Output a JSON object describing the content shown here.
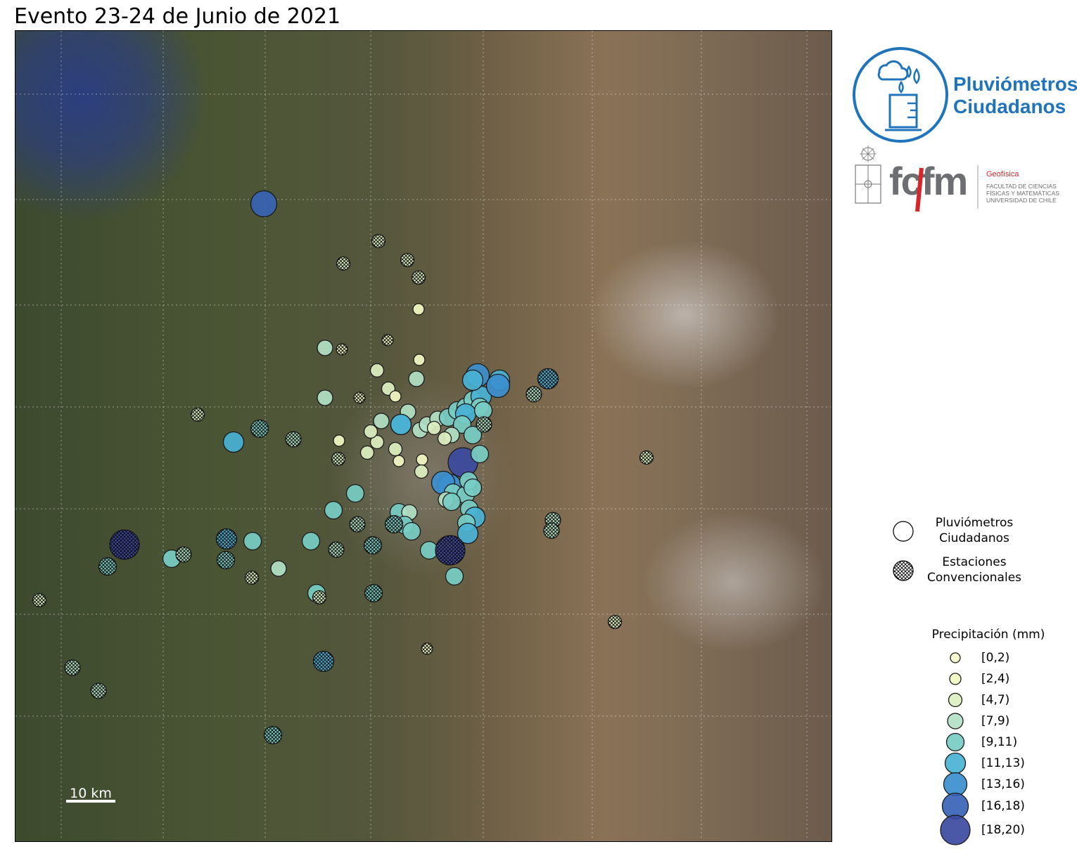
{
  "title": "Evento 23-24 de Junio de 2021",
  "scale_bar": {
    "label": "10 km"
  },
  "logos": {
    "pluviometros": {
      "line1": "Pluviómetros",
      "line2": "Ciudadanos",
      "color": "#1f74bb"
    },
    "fcfm": {
      "acronym": "fcfm",
      "department": "Geofísica",
      "line1": "FACULTAD DE CIENCIAS",
      "line2": "FÍSICAS Y MATEMÁTICAS",
      "line3": "UNIVERSIDAD DE CHILE",
      "accent": "#d7262b"
    }
  },
  "legend": {
    "types": [
      {
        "label": "Pluviómetros Ciudadanos",
        "line1": "Pluviómetros",
        "line2": "Ciudadanos",
        "hatched": false
      },
      {
        "label": "Estaciones Convencionales",
        "line1": "Estaciones",
        "line2": "Convencionales",
        "hatched": true
      }
    ],
    "precip_title": "Precipitación (mm)",
    "classes": [
      {
        "label": "[0,2)",
        "color": "#fdfdd0"
      },
      {
        "label": "[2,4)",
        "color": "#f3f8c3"
      },
      {
        "label": "[4,7)",
        "color": "#dcf0c0"
      },
      {
        "label": "[7,9)",
        "color": "#b2e1c4"
      },
      {
        "label": "[9,11)",
        "color": "#77cdc4"
      },
      {
        "label": "[11,13)",
        "color": "#49b2d4"
      },
      {
        "label": "[13,16)",
        "color": "#3b8fcf"
      },
      {
        "label": "[16,18)",
        "color": "#3763b5"
      },
      {
        "label": "[18,20)",
        "color": "#3b4aa0"
      }
    ]
  },
  "stations": {
    "ciudadanos": [
      {
        "c": 7,
        "p": [
          353,
          246
        ]
      },
      {
        "c": 5,
        "p": [
          310,
          585
        ]
      },
      {
        "c": 3,
        "p": [
          440,
          451
        ]
      },
      {
        "c": 3,
        "p": [
          440,
          522
        ]
      },
      {
        "c": 1,
        "p": [
          573,
          396
        ]
      },
      {
        "c": 1,
        "p": [
          574,
          468
        ]
      },
      {
        "c": 2,
        "p": [
          514,
          483
        ]
      },
      {
        "c": 2,
        "p": [
          530,
          509
        ]
      },
      {
        "c": 3,
        "p": [
          570,
          495
        ]
      },
      {
        "c": 1,
        "p": [
          540,
          520
        ]
      },
      {
        "c": 3,
        "p": [
          558,
          542
        ]
      },
      {
        "c": 5,
        "p": [
          548,
          560
        ]
      },
      {
        "c": 3,
        "p": [
          575,
          568
        ]
      },
      {
        "c": 3,
        "p": [
          585,
          560
        ]
      },
      {
        "c": 3,
        "p": [
          600,
          552
        ]
      },
      {
        "c": 4,
        "p": [
          615,
          550
        ]
      },
      {
        "c": 4,
        "p": [
          628,
          540
        ]
      },
      {
        "c": 4,
        "p": [
          640,
          535
        ]
      },
      {
        "c": 4,
        "p": [
          650,
          525
        ]
      },
      {
        "c": 5,
        "p": [
          662,
          520
        ]
      },
      {
        "c": 6,
        "p": [
          657,
          490
        ]
      },
      {
        "c": 5,
        "p": [
          688,
          497
        ]
      },
      {
        "c": 6,
        "p": [
          686,
          505
        ]
      },
      {
        "c": 5,
        "p": [
          650,
          497
        ]
      },
      {
        "c": 4,
        "p": [
          660,
          535
        ]
      },
      {
        "c": 5,
        "p": [
          640,
          545
        ]
      },
      {
        "c": 4,
        "p": [
          635,
          560
        ]
      },
      {
        "c": 4,
        "p": [
          650,
          575
        ]
      },
      {
        "c": 3,
        "p": [
          620,
          575
        ]
      },
      {
        "c": 2,
        "p": [
          610,
          580
        ]
      },
      {
        "c": 2,
        "p": [
          595,
          565
        ]
      },
      {
        "c": 1,
        "p": [
          578,
          610
        ]
      },
      {
        "c": 2,
        "p": [
          577,
          627
        ]
      },
      {
        "c": 1,
        "p": [
          545,
          612
        ]
      },
      {
        "c": 2,
        "p": [
          500,
          600
        ]
      },
      {
        "c": 2,
        "p": [
          514,
          585
        ]
      },
      {
        "c": 1,
        "p": [
          460,
          583
        ]
      },
      {
        "c": 2,
        "p": [
          505,
          570
        ]
      },
      {
        "c": 3,
        "p": [
          520,
          555
        ]
      },
      {
        "c": 2,
        "p": [
          540,
          595
        ]
      },
      {
        "c": 8,
        "p": [
          636,
          614
        ]
      },
      {
        "c": 6,
        "p": [
          617,
          647
        ]
      },
      {
        "c": 6,
        "p": [
          608,
          643
        ]
      },
      {
        "c": 4,
        "p": [
          622,
          657
        ]
      },
      {
        "c": 3,
        "p": [
          612,
          667
        ]
      },
      {
        "c": 4,
        "p": [
          640,
          660
        ]
      },
      {
        "c": 4,
        "p": [
          620,
          670
        ]
      },
      {
        "c": 4,
        "p": [
          645,
          680
        ]
      },
      {
        "c": 5,
        "p": [
          653,
          692
        ]
      },
      {
        "c": 4,
        "p": [
          641,
          700
        ]
      },
      {
        "c": 5,
        "p": [
          643,
          715
        ]
      },
      {
        "c": 4,
        "p": [
          483,
          658
        ]
      },
      {
        "c": 4,
        "p": [
          452,
          682
        ]
      },
      {
        "c": 4,
        "p": [
          545,
          685
        ]
      },
      {
        "c": 3,
        "p": [
          560,
          685
        ]
      },
      {
        "c": 4,
        "p": [
          553,
          703
        ]
      },
      {
        "c": 4,
        "p": [
          563,
          712
        ]
      },
      {
        "c": 4,
        "p": [
          420,
          726
        ]
      },
      {
        "c": 4,
        "p": [
          337,
          726
        ]
      },
      {
        "c": 4,
        "p": [
          222,
          751
        ]
      },
      {
        "c": 3,
        "p": [
          374,
          765
        ]
      },
      {
        "c": 4,
        "p": [
          588,
          739
        ]
      },
      {
        "c": 4,
        "p": [
          624,
          776
        ]
      },
      {
        "c": 4,
        "p": [
          428,
          800
        ]
      },
      {
        "c": 5,
        "p": [
          548,
          560
        ]
      },
      {
        "c": 4,
        "p": [
          665,
          540
        ]
      },
      {
        "c": 4,
        "p": [
          660,
          602
        ]
      },
      {
        "c": 4,
        "p": [
          644,
          640
        ]
      },
      {
        "c": 4,
        "p": [
          650,
          650
        ]
      }
    ],
    "convencionales": [
      {
        "c": 2,
        "p": [
          516,
          299
        ]
      },
      {
        "c": 2,
        "p": [
          466,
          331
        ]
      },
      {
        "c": 2,
        "p": [
          557,
          326
        ]
      },
      {
        "c": 2,
        "p": [
          573,
          351
        ]
      },
      {
        "c": 1,
        "p": [
          464,
          453
        ]
      },
      {
        "c": 1,
        "p": [
          529,
          440
        ]
      },
      {
        "c": 1,
        "p": [
          489,
          522
        ]
      },
      {
        "c": 2,
        "p": [
          259,
          546
        ]
      },
      {
        "c": 4,
        "p": [
          347,
          566
        ]
      },
      {
        "c": 3,
        "p": [
          395,
          581
        ]
      },
      {
        "c": 2,
        "p": [
          459,
          609
        ]
      },
      {
        "c": 5,
        "p": [
          757,
          495
        ]
      },
      {
        "c": 3,
        "p": [
          737,
          517
        ]
      },
      {
        "c": 2,
        "p": [
          897,
          607
        ]
      },
      {
        "c": 8,
        "p": [
          155,
          731
        ]
      },
      {
        "c": 5,
        "p": [
          300,
          723
        ]
      },
      {
        "c": 4,
        "p": [
          299,
          753
        ]
      },
      {
        "c": 3,
        "p": [
          239,
          745
        ]
      },
      {
        "c": 4,
        "p": [
          131,
          762
        ]
      },
      {
        "c": 2,
        "p": [
          336,
          778
        ]
      },
      {
        "c": 2,
        "p": [
          34,
          810
        ]
      },
      {
        "c": 3,
        "p": [
          486,
          702
        ]
      },
      {
        "c": 4,
        "p": [
          508,
          732
        ]
      },
      {
        "c": 3,
        "p": [
          456,
          738
        ]
      },
      {
        "c": 4,
        "p": [
          538,
          702
        ]
      },
      {
        "c": 8,
        "p": [
          618,
          739
        ]
      },
      {
        "c": 4,
        "p": [
          509,
          800
        ]
      },
      {
        "c": 2,
        "p": [
          432,
          806
        ]
      },
      {
        "c": 3,
        "p": [
          764,
          696
        ]
      },
      {
        "c": 3,
        "p": [
          762,
          711
        ]
      },
      {
        "c": 2,
        "p": [
          852,
          841
        ]
      },
      {
        "c": 1,
        "p": [
          585,
          879
        ]
      },
      {
        "c": 5,
        "p": [
          438,
          897
        ]
      },
      {
        "c": 3,
        "p": [
          81,
          906
        ]
      },
      {
        "c": 3,
        "p": [
          118,
          939
        ]
      },
      {
        "c": 4,
        "p": [
          366,
          1002
        ]
      },
      {
        "c": 3,
        "p": [
          666,
          560
        ]
      }
    ]
  }
}
